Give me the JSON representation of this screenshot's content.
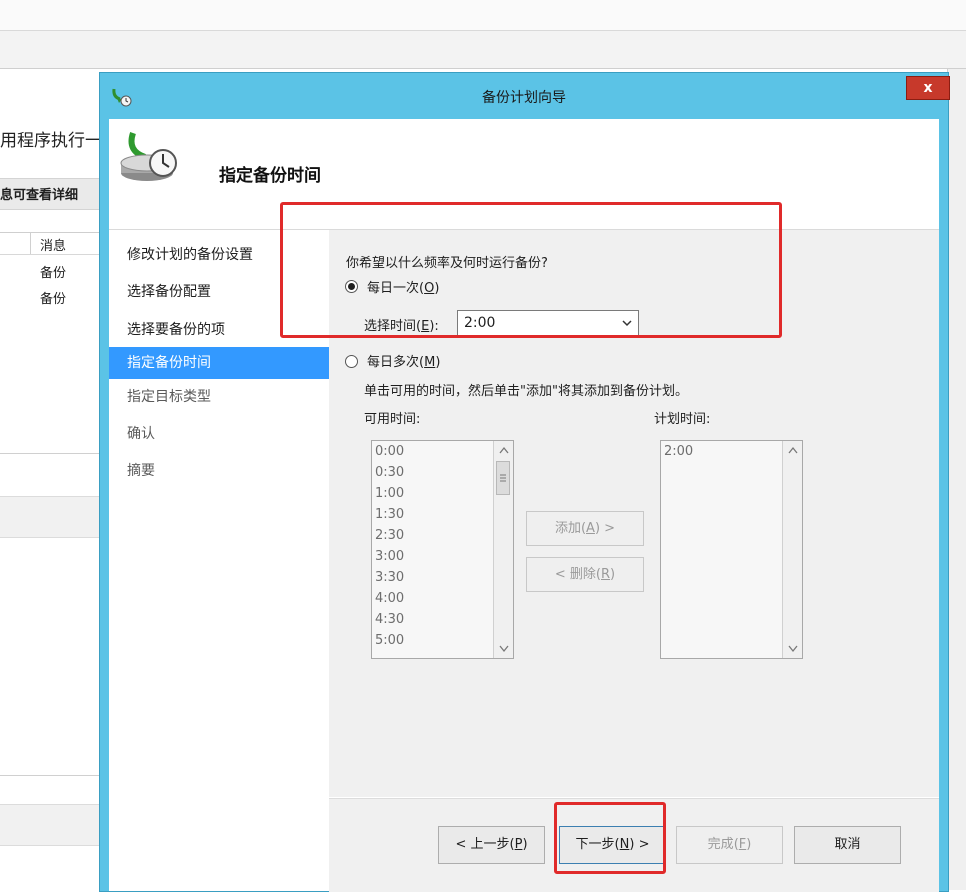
{
  "background_app": {
    "title_fragment": "用程序执行一",
    "subtitle_fragment": "息可查看详细",
    "column_header": "消息",
    "rows": [
      "备份",
      "备份"
    ]
  },
  "dialog": {
    "title": "备份计划向导",
    "close_label": "x",
    "header_title": "指定备份时间",
    "nav": [
      {
        "label": "修改计划的备份设置",
        "state": "done"
      },
      {
        "label": "选择备份配置",
        "state": "done"
      },
      {
        "label": "选择要备份的项",
        "state": "done"
      },
      {
        "label": "指定备份时间",
        "state": "active"
      },
      {
        "label": "指定目标类型",
        "state": "pending"
      },
      {
        "label": "确认",
        "state": "pending"
      },
      {
        "label": "摘要",
        "state": "pending"
      }
    ],
    "content": {
      "question": "你希望以什么频率及何时运行备份?",
      "daily_option": {
        "label": "每日一次",
        "accel": "O",
        "selected": true
      },
      "time_label": "选择时间",
      "time_accel": "E",
      "time_label_suffix": ":",
      "time_value": "2:00",
      "multi_option": {
        "label": "每日多次",
        "accel": "M",
        "selected": false
      },
      "multi_hint": "单击可用的时间，然后单击\"添加\"将其添加到备份计划。",
      "available_label": "可用时间:",
      "scheduled_label": "计划时间:",
      "available_times": [
        "0:00",
        "0:30",
        "1:00",
        "1:30",
        "2:30",
        "3:00",
        "3:30",
        "4:00",
        "4:30",
        "5:00"
      ],
      "scheduled_times": [
        "2:00"
      ],
      "add_button": {
        "label": "添加",
        "accel": "A",
        "suffix": " >"
      },
      "remove_button": {
        "prefix": "< ",
        "label": "删除",
        "accel": "R"
      }
    },
    "footer": {
      "back": {
        "prefix": "< 上一步",
        "accel": "P"
      },
      "next": {
        "prefix": "下一步",
        "accel": "N",
        "suffix": " >"
      },
      "finish": {
        "prefix": "完成",
        "accel": "F"
      },
      "cancel": "取消"
    }
  },
  "colors": {
    "title_bar": "#5bc3e6",
    "selection": "#3399ff",
    "annotation": "#e02a2a",
    "close": "#c7392b"
  }
}
